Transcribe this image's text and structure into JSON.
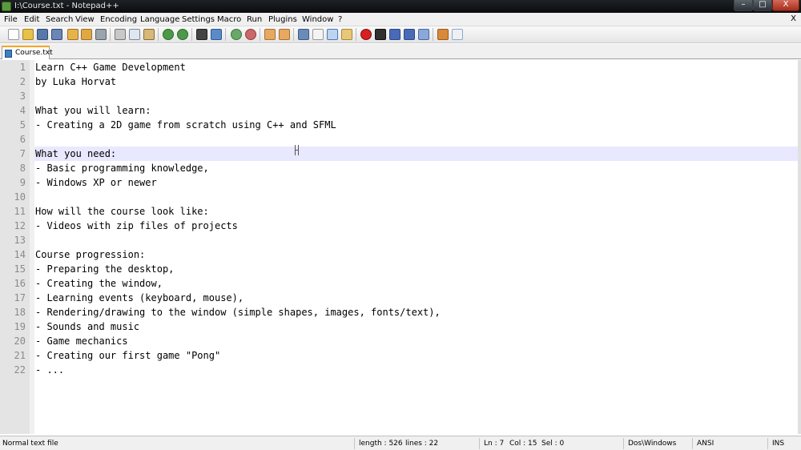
{
  "window": {
    "title": "I:\\Course.txt - Notepad++",
    "controls": {
      "minimize": "–",
      "maximize": "□",
      "close": "X"
    }
  },
  "menu": {
    "items": [
      "File",
      "Edit",
      "Search",
      "View",
      "Encoding",
      "Language",
      "Settings",
      "Macro",
      "Run",
      "Plugins",
      "Window",
      "?"
    ],
    "close_label": "X"
  },
  "toolbar": {
    "icons": [
      "new-file-icon",
      "open-file-icon",
      "save-icon",
      "save-all-icon",
      "close-icon",
      "close-all-icon",
      "print-icon",
      "cut-icon",
      "copy-icon",
      "paste-icon",
      "undo-icon",
      "redo-icon",
      "find-icon",
      "replace-icon",
      "zoom-in-icon",
      "zoom-out-icon",
      "sync-vertical-icon",
      "sync-horizontal-icon",
      "word-wrap-icon",
      "show-all-chars-icon",
      "indent-guide-icon",
      "folder-as-workspace-icon",
      "record-macro-icon",
      "stop-macro-icon",
      "play-macro-icon",
      "run-macro-multiple-icon",
      "save-macro-icon",
      "launch-browser-icon",
      "spellcheck-icon"
    ]
  },
  "tabs": [
    {
      "label": "Course.txt",
      "active": true
    }
  ],
  "editor": {
    "current_line": 7,
    "lines": [
      "Learn C++ Game Development",
      "by Luka Horvat",
      "",
      "What you will learn:",
      "- Creating a 2D game from scratch using C++ and SFML",
      "",
      "What you need:",
      "- Basic programming knowledge,",
      "- Windows XP or newer",
      "",
      "How will the course look like:",
      "- Videos with zip files of projects",
      "",
      "Course progression:",
      "- Preparing the desktop,",
      "- Creating the window,",
      "- Learning events (keyboard, mouse),",
      "- Rendering/drawing to the window (simple shapes, images, fonts/text),",
      "- Sounds and music",
      "- Game mechanics",
      "- Creating our first game \"Pong\"",
      "- ..."
    ]
  },
  "status": {
    "file_type": "Normal text file",
    "length": "length : 526",
    "lines": "lines : 22",
    "ln": "Ln : 7",
    "col": "Col : 15",
    "sel": "Sel : 0",
    "eol": "Dos\\Windows",
    "encoding": "ANSI",
    "mode": "INS"
  },
  "colors": {
    "current_line_highlight": "#e8e8ff",
    "active_tab_accent": "#f5a623",
    "gutter": "#e4e4e4"
  }
}
